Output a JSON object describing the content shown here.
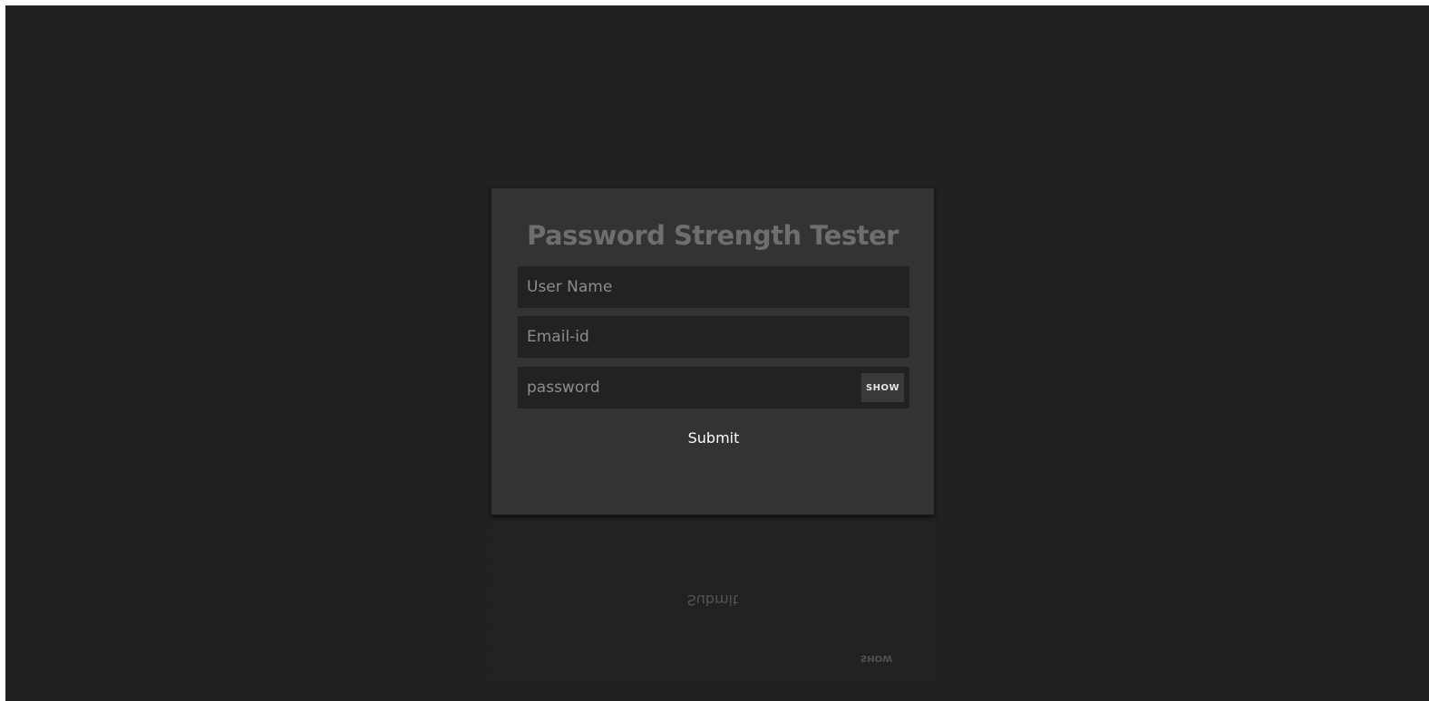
{
  "form": {
    "title": "Password Strength Tester",
    "username_placeholder": "User Name",
    "email_placeholder": "Email-id",
    "password_placeholder": "password",
    "show_label": "SHOW",
    "submit_label": "Submit"
  },
  "colors": {
    "page_background": "#212121",
    "card_background": "#333333",
    "input_background": "#222222",
    "title_color": "#6e6e6e"
  }
}
